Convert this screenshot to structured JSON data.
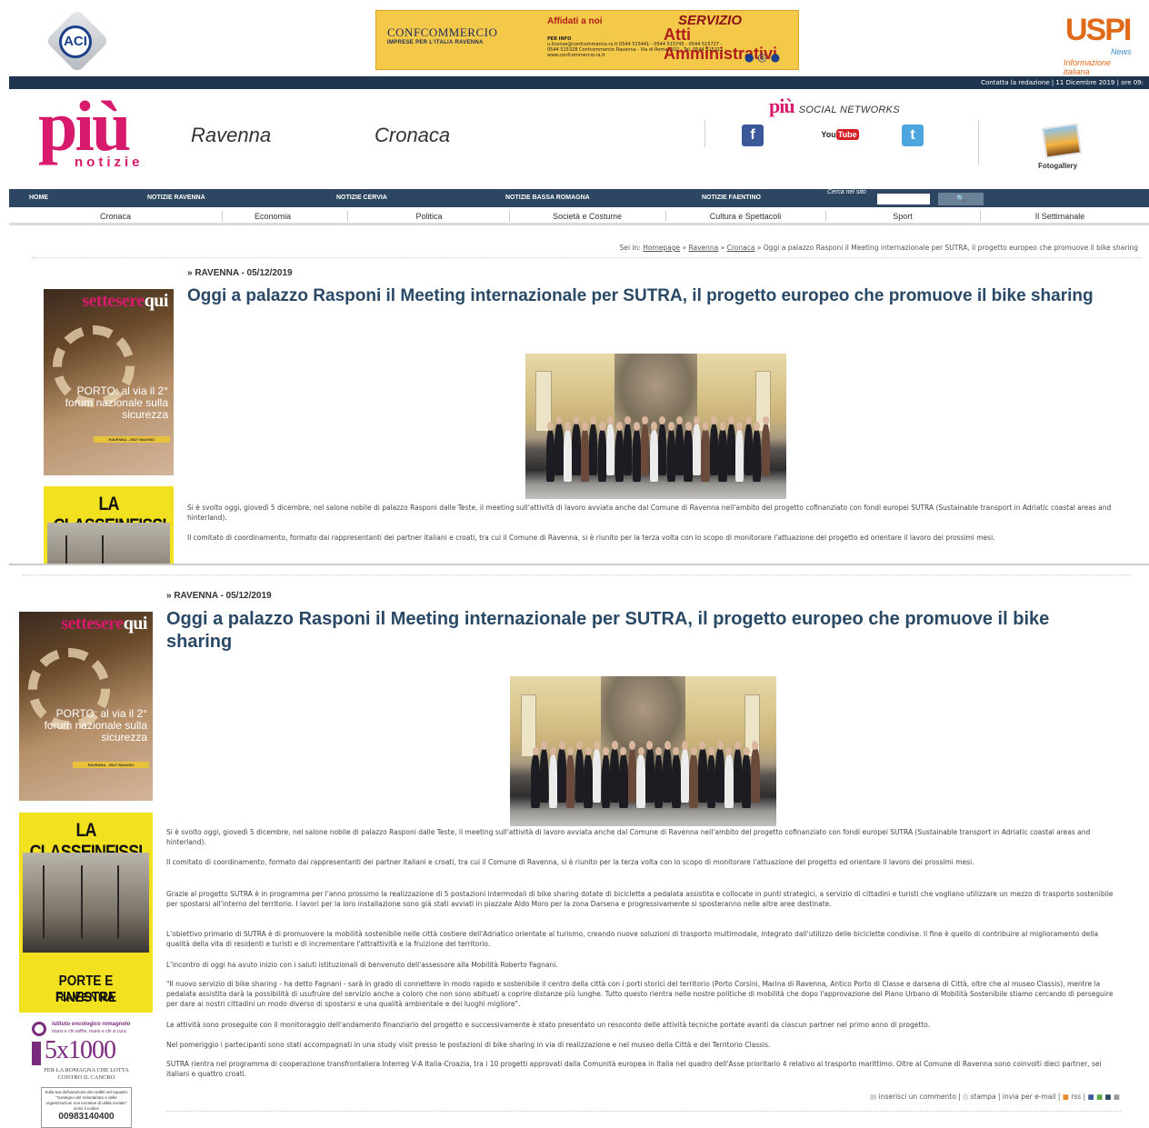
{
  "header": {
    "aci_logo": "ACI",
    "banner": {
      "left_title": "CONFCOMMERCIO",
      "left_sub": "IMPRESE PER L'ITALIA RAVENNA",
      "affidati": "Affidati a noi",
      "servizio": "SERVIZIO",
      "atti": "Atti Amministrativi",
      "per_info": "PER INFO",
      "info_lines": "u.licenze@confcommercio.ra.it  0544 515441 - 0544 515745 - 0544 515727 - 0544 515328  Confcommercio Ravenna - Via di Roma, 102 - Tel. 0544 515311 - www.confcommercio.ra.it"
    },
    "uspi": {
      "logo": "USPI",
      "news": "News",
      "tagline": "Informazione italiana"
    },
    "topline": "Contatta la redazione  |  11 Dicembre 2019  |  ore 09:",
    "logo_piu": "più",
    "logo_notizie": "notizie",
    "city": "Ravenna",
    "section": "Cronaca",
    "social_brand": "più",
    "social_title": "SOCIAL NETWORKS",
    "fotogallery": "Fotogallery"
  },
  "nav_main": [
    "HOME",
    "NOTIZIE RAVENNA",
    "NOTIZIE CERVIA",
    "NOTIZIE BASSA ROMAGNA",
    "NOTIZIE FAENTINO"
  ],
  "search": {
    "label": "Cerca nel sito",
    "button": "🔍"
  },
  "nav_sub": [
    "Cronaca",
    "Economia",
    "Politica",
    "Società e Costume",
    "Cultura e Spettacoli",
    "Sport",
    "Il Settimanale"
  ],
  "breadcrumb": {
    "prefix": "Sei in:",
    "items": [
      "Homepage",
      "Ravenna",
      "Cronaca"
    ],
    "current": "Oggi a palazzo Rasponi il Meeting internazionale per SUTRA, il progetto europeo che promuove il bike sharing"
  },
  "article": {
    "date": "» RAVENNA - 05/12/2019",
    "title": "Oggi a palazzo Rasponi il Meeting internazionale per SUTRA, il progetto europeo che promuove il bike sharing",
    "paragraphs": [
      "Si è svolto oggi, giovedì 5 dicembre, nel salone nobile di palazzo Rasponi dalle Teste, il meeting  sull'attività di lavoro avviata anche dal Comune di Ravenna nell'ambito del progetto cofinanziato con fondi europei SUTRA (Sustainable transport in Adriatic coastal areas and hinterland).",
      "Il comitato di coordinamento, formato dai rappresentanti dei partner italiani e croati, tra cui il Comune di Ravenna, si è riunito per la terza volta con lo scopo di monitorare l'attuazione del progetto ed orientare il lavoro dei prossimi mesi.",
      "Grazie al progetto SUTRA è in programma per l'anno prossimo la realizzazione di 5 postazioni intermodali di bike sharing dotate di biciclette a pedalata assistita e collocate in punti strategici, a servizio di cittadini e turisti che vogliano utilizzare un mezzo di trasporto sostenibile per spostarsi all'interno del territorio. I lavori per la loro installazione sono già stati avviati in piazzale Aldo Moro per la zona Darsena e progressivamente si sposteranno nelle altre aree destinate.",
      "L'obiettivo primario di SUTRA è di promuovere la mobilità sostenibile nelle città costiere dell'Adriatico orientate al turismo, creando nuove soluzioni di trasporto multimodale, integrato dall'utilizzo delle biciclette condivise. Il fine è quello di contribuire al miglioramento della qualità della vita di residenti e turisti e di incrementare l'attrattività e la fruizione del territorio.",
      "L'incontro di oggi ha avuto inizio con i saluti istituzionali di benvenuto dell'assessore alla Mobilità Roberto Fagnani.",
      "\"Il nuovo servizio di bike sharing - ha detto Fagnani - sarà in grado di connettere in modo rapido e sostenibile il centro della città con i porti storici del territorio (Porto Corsini, Marina di Ravenna, Antico Porto di Classe e darsena di Città, oltre che al museo Classis), mentre la pedalata assistita darà la possibilità di usufruire del servizio anche a coloro che non sono abituati a coprire distanze più lunghe. Tutto questo rientra nelle nostre politiche di mobilità che dopo l'approvazione del Piano Urbano di Mobilità Sostenibile stiamo cercando di perseguire per dare ai nostri cittadini un modo diverso di spostarsi e una qualità ambientale e dei luoghi migliore\".",
      "Le attività sono proseguite con il monitoraggio dell'andamento finanziario del progetto e successivamente è stato presentato un resoconto delle attività tecniche portate avanti da ciascun partner nel primo anno di progetto.",
      "Nel pomeriggio i partecipanti sono stati accompagnati in una study visit presso le postazioni di bike sharing in via di realizzazione e nel museo della Città e del Territorio Classis.",
      "SUTRA rientra nel programma di cooperazione transfrontaliera Interreg V-A Italia-Croazia, tra i 10 progetti approvati dalla Comunità europea in Italia nel quadro dell'Asse prioritario 4 relativo al trasporto marittimo. Oltre al Comune di Ravenna sono coinvolti dieci partner, sei italiani e quattro croati."
    ],
    "tools": [
      "inserisci un commento",
      "stampa",
      "invia per e-mail",
      "rss"
    ]
  },
  "ads": {
    "sette": {
      "masthead_a": "settesere",
      "masthead_b": "qui",
      "text": "PORTO: al via il 2° forum nazionale sulla sicurezza",
      "strip": "RAVENNA - 25/27 MAGGIO"
    },
    "classe": {
      "title": "LA CLASSEINFISSI",
      "line1": "PORTE E FINESTRE",
      "line2": "RAVENNA"
    },
    "onco": {
      "org": "istituto oncologico romagnolo",
      "org_sub": "mano e chi soffre, mano e chi si cura",
      "five": "5x1000",
      "cause": "PER LA ROMAGNA CHE LOTTA CONTRO IL CANCRO",
      "box": "Sulla tua dichiarazione dei redditi nel riquadro \"Sostegno del Volontariato e delle organizzazioni non lucrative di utilità sociale\" scrivi il codice",
      "code": "00983140400"
    }
  }
}
